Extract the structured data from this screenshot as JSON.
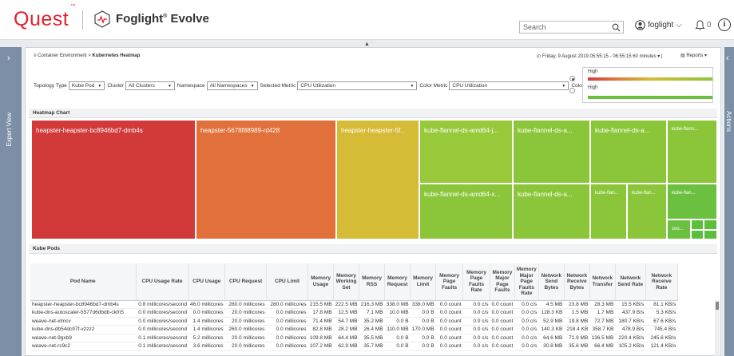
{
  "header": {
    "quest_logo": "Quest",
    "quest_tm": "™",
    "product": "Foglight",
    "product_reg": "®",
    "product_suffix": " Evolve",
    "search_placeholder": "Search",
    "user": "foglight",
    "alerts_count": "0"
  },
  "sidebar_left_label": "Expert View",
  "sidebar_right_label": "Actions",
  "breadcrumb": {
    "parent": "Container Environment",
    "separator": " > ",
    "current": "Kubernetes Heatmap"
  },
  "time_range": "Friday, 9 August 2019 05:55:15 - 06:55:15 60 minutes",
  "reports_label": "Reports",
  "filters": {
    "topology_type_label": "Topology Type",
    "topology_type_value": "Kube Pod",
    "cluster_label": "Cluster",
    "cluster_value": "All Clusters",
    "namespace_label": "Namespace",
    "namespace_value": "All Namespaces",
    "selected_metric_label": "Selected Metric",
    "selected_metric_value": "CPU Utilization",
    "color_metric_label": "Color Metric",
    "color_metric_value": "CPU Utilization",
    "color_pattern_label": "Color Pattern"
  },
  "legend": {
    "high_1": "High",
    "high_2": "High"
  },
  "heatmap": {
    "title": "Heatmap Chart",
    "tiles": [
      {
        "label": "heapster-heapster-bc8946bd7-dmb4s",
        "color": "#d23a3a"
      },
      {
        "label": "heapster-5678f88989-rd428",
        "color": "#e1703a"
      },
      {
        "label": "heapster-heapster-5f...",
        "color": "#d5bb36"
      },
      {
        "label": "kube-flannel-ds-amd64-j...",
        "color": "#97c93b"
      },
      {
        "label": "kube-flannel-ds-a...",
        "color": "#8bc63a"
      },
      {
        "label": "kube-flannel-ds-a...",
        "color": "#8bc63a"
      },
      {
        "label": "kube-flann...",
        "color": "#8bc63a"
      },
      {
        "label": "kube-flannel-ds-amd64-x...",
        "color": "#8bc63a"
      },
      {
        "label": "kube-flannel-ds-a...",
        "color": "#8bc63a"
      },
      {
        "label": "kube-flan...",
        "color": "#8bc63a"
      },
      {
        "label": "kube-flan...",
        "color": "#8bc63a"
      },
      {
        "label": "kube-flan...",
        "color": "#6cc040"
      },
      {
        "label": "zoo...",
        "color": "#6cc040"
      }
    ]
  },
  "pods": {
    "title": "Kube Pods",
    "columns": [
      "Pod Name",
      "CPU Usage Rate",
      "CPU Usage",
      "CPU Request",
      "CPU Limit",
      "Memory Usage",
      "Memory Working Set",
      "Memory RSS",
      "Memory Request",
      "Memory Limit",
      "Memory Page Faults",
      "Memory Page Faults Rate",
      "Memory Major Page Faults",
      "Memory Major Page Faults Rate",
      "Network Send Bytes",
      "Network Receive Bytes",
      "Network Transfer",
      "Network Send Rate",
      "Network Receive Rate"
    ],
    "rows": [
      [
        "heapster-heapster-bc8946bd7-dmb4s",
        "0.8 millicores/second",
        "46.0 millicores",
        "280.0 millicores",
        "280.0 millicores",
        "215.5 MB",
        "222.5 MB",
        "216.3 MB",
        "338.0 MB",
        "338.0 MB",
        "0.0 count",
        "0.0 c/s",
        "0.0 count",
        "0.0 c/s",
        "4.5 MB",
        "23.8 MB",
        "28.3 MB",
        "15.5 KB/s",
        "81.1 KB/s"
      ],
      [
        "kube-dns-autoscaler-5577d6dbdb-ckfn5",
        "0.0 millicores/second",
        "0.0 millicores",
        "20.0 millicores",
        "0.0 millicores",
        "17.8 MB",
        "12.5 MB",
        "7.1 MB",
        "10.0 MB",
        "0.0 B",
        "0.0 count",
        "0.0 c/s",
        "0.0 count",
        "0.0 c/s",
        "128.3 KB",
        "1.5 MB",
        "1.7 MB",
        "437.9 B/s",
        "5.3 KB/s"
      ],
      [
        "weave-net-xlmcv",
        "0.0 millicores/second",
        "1.4 millicores",
        "20.0 millicores",
        "0.0 millicores",
        "71.4 MB",
        "54.7 MB",
        "35.2 MB",
        "0.0 B",
        "0.0 B",
        "0.0 count",
        "0.0 c/s",
        "0.0 count",
        "0.0 c/s",
        "52.9 MB",
        "19.8 MB",
        "72.7 MB",
        "180.7 KB/s",
        "67.6 KB/s"
      ],
      [
        "kube-dns-db54dc97f-v2zz2",
        "0.0 millicores/second",
        "1.4 millicores",
        "260.0 millicores",
        "0.0 millicores",
        "82.8 MB",
        "28.2 MB",
        "26.4 MB",
        "110.0 MB",
        "170.0 MB",
        "0.0 count",
        "0.0 c/s",
        "0.0 count",
        "0.0 c/s",
        "140.3 KB",
        "218.4 KB",
        "358.7 KB",
        "478.9 B/s",
        "745.4 B/s"
      ],
      [
        "weave-net-9gxb9",
        "0.1 millicores/second",
        "5.2 millicores",
        "20.0 millicores",
        "0.0 millicores",
        "109.8 MB",
        "64.4 MB",
        "35.5 MB",
        "0.0 B",
        "0.0 B",
        "0.0 count",
        "0.0 c/s",
        "0.0 count",
        "0.0 c/s",
        "64.6 MB",
        "71.9 MB",
        "136.5 MB",
        "220.4 KB/s",
        "245.6 KB/s"
      ],
      [
        "weave-net-rc9c2",
        "0.1 millicores/second",
        "3.6 millicores",
        "20.0 millicores",
        "0.0 millicores",
        "107.2 MB",
        "62.9 MB",
        "35.7 MB",
        "0.0 B",
        "0.0 B",
        "0.0 count",
        "0.0 c/s",
        "0.0 count",
        "0.0 c/s",
        "30.8 MB",
        "35.6 MB",
        "66.4 MB",
        "105.2 KB/s",
        "121.4 KB/s"
      ]
    ]
  }
}
